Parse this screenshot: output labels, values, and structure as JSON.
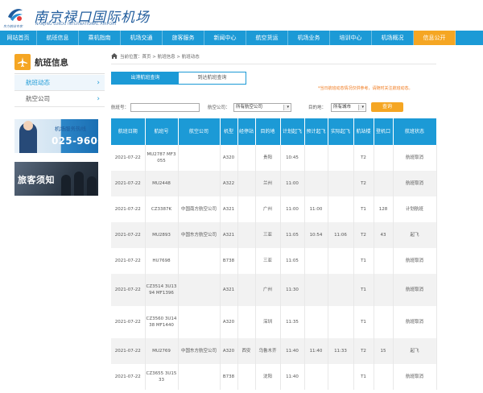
{
  "header": {
    "logo_tag": "东方航站专家",
    "logo_cn": "南京禄口国际机场",
    "logo_en": "NANJING LUKOU INTERNATIONAL AIRPORT"
  },
  "nav": [
    "网站首页",
    "航班信息",
    "乘机指南",
    "机场交通",
    "旅客服务",
    "新闻中心",
    "航空货运",
    "机场业务",
    "培训中心",
    "机场概况",
    "信息公开"
  ],
  "sidebar": {
    "title": "航班信息",
    "items": [
      "航班动态",
      "航空公司"
    ]
  },
  "ads": {
    "hotline_label": "机场服务热线",
    "hotline_number": "025-96066",
    "notice": "旅客须知"
  },
  "breadcrumb": "当前位置：首页 > 航班信息 > 航班动态",
  "tabs": [
    "出港航班查询",
    "到达航班查询"
  ],
  "notice_text": "*当日航班动态情况仅供参考，请随时关注航班动态。",
  "filters": {
    "flight_label": "航班号：",
    "flight_value": "",
    "airline_label": "航空公司：",
    "airline_value": "所有航空公司",
    "dest_label": "目的地：",
    "dest_value": "所有城市",
    "search_label": "查询"
  },
  "table": {
    "headers": [
      "航班日期",
      "航班号",
      "航空公司",
      "机型",
      "经停站",
      "目的地",
      "计划起飞",
      "预计起飞",
      "实际起飞",
      "航站楼",
      "登机口",
      "航班状态"
    ],
    "rows": [
      [
        "2021-07-22",
        "MU2787 MF3055",
        "",
        "A320",
        "",
        "贵阳",
        "10:45",
        "",
        "",
        "T2",
        "",
        "航班取消"
      ],
      [
        "2021-07-22",
        "MU2448",
        "",
        "A322",
        "",
        "兰州",
        "11:00",
        "",
        "",
        "T2",
        "",
        "航班取消"
      ],
      [
        "2021-07-22",
        "CZ3387K",
        "中国南方航空公司",
        "A321",
        "",
        "广州",
        "11:00",
        "11:00",
        "",
        "T1",
        "128",
        "计划航班"
      ],
      [
        "2021-07-22",
        "MU2893",
        "中国东方航空公司",
        "A321",
        "",
        "三亚",
        "11:05",
        "10:54",
        "11:06",
        "T2",
        "43",
        "起飞"
      ],
      [
        "2021-07-22",
        "HU7698",
        "",
        "B738",
        "",
        "三亚",
        "11:05",
        "",
        "",
        "T1",
        "",
        "航班取消"
      ],
      [
        "2021-07-22",
        "CZ3514 3U1394 MF1396",
        "",
        "A321",
        "",
        "广州",
        "11:30",
        "",
        "",
        "T1",
        "",
        "航班取消"
      ],
      [
        "2021-07-22",
        "CZ3560 3U1438 MF1440",
        "",
        "A320",
        "",
        "深圳",
        "11:35",
        "",
        "",
        "T1",
        "",
        "航班取消"
      ],
      [
        "2021-07-22",
        "MU2769",
        "中国东方航空公司",
        "A320",
        "西安",
        "乌鲁木齐",
        "11:40",
        "11:40",
        "11:33",
        "T2",
        "15",
        "起飞"
      ],
      [
        "2021-07-22",
        "CZ3655 3U1533",
        "",
        "B738",
        "",
        "沈阳",
        "11:40",
        "",
        "",
        "T1",
        "",
        "航班取消"
      ]
    ]
  },
  "colors": {
    "nav_blue": "#1c9ad6",
    "accent_orange": "#f5a623",
    "notice_orange": "#f07a1e"
  },
  "icons": [
    "logo-icon",
    "plane-icon",
    "home-icon",
    "chevron-right-icon",
    "select-arrow-icon"
  ]
}
